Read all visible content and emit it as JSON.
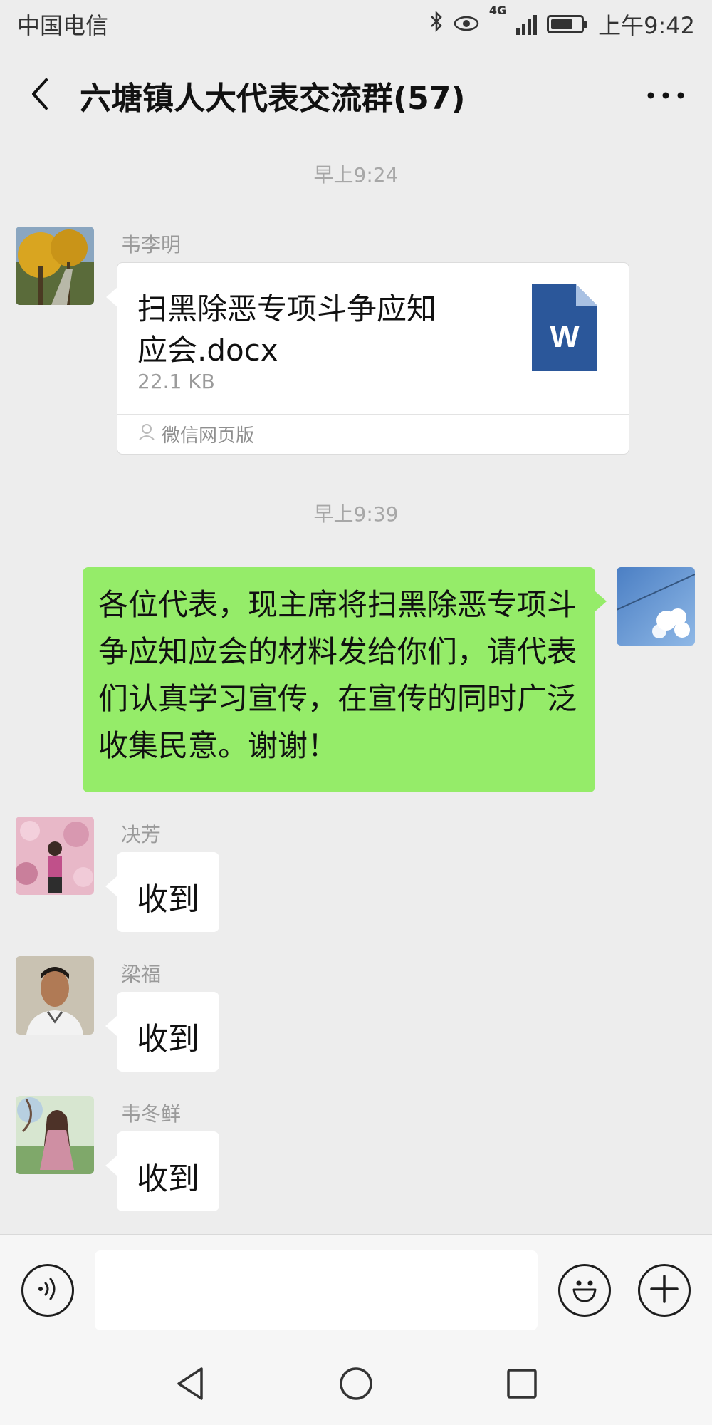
{
  "status_bar": {
    "carrier": "中国电信",
    "network": "4G",
    "time": "上午9:42"
  },
  "header": {
    "title": "六塘镇人大代表交流群(57)",
    "back_icon": "chevron-left-icon",
    "more_icon": "more-dots-icon"
  },
  "messages": [
    {
      "type": "time",
      "text": "早上9:24"
    },
    {
      "type": "file",
      "sender": "韦李明",
      "file_name": "扫黑除恶专项斗争应知应会.docx",
      "file_name_line1": "扫黑除恶专项斗争应知",
      "file_name_line2": "应会.docx",
      "file_size": "22.1 KB",
      "file_icon_letter": "W",
      "source": "微信网页版"
    },
    {
      "type": "time",
      "text": "早上9:39"
    },
    {
      "type": "text_self",
      "text": "各位代表，现主席将扫黑除恶专项斗争应知应会的材料发给你们，请代表们认真学习宣传，在宣传的同时广泛收集民意。谢谢！"
    },
    {
      "type": "text",
      "sender": "决芳",
      "text": "收到"
    },
    {
      "type": "text",
      "sender": "梁福",
      "text": "收到"
    },
    {
      "type": "text",
      "sender": "韦冬鲜",
      "text": "收到"
    }
  ],
  "input_bar": {
    "voice_icon": "voice-icon",
    "emoji_icon": "emoji-icon",
    "plus_icon": "plus-icon",
    "input_value": ""
  },
  "nav": {
    "back": "nav-back-icon",
    "home": "nav-home-icon",
    "recents": "nav-recents-icon"
  },
  "colors": {
    "background": "#ededed",
    "self_bubble": "#95ec69",
    "word_blue": "#2b579a"
  }
}
